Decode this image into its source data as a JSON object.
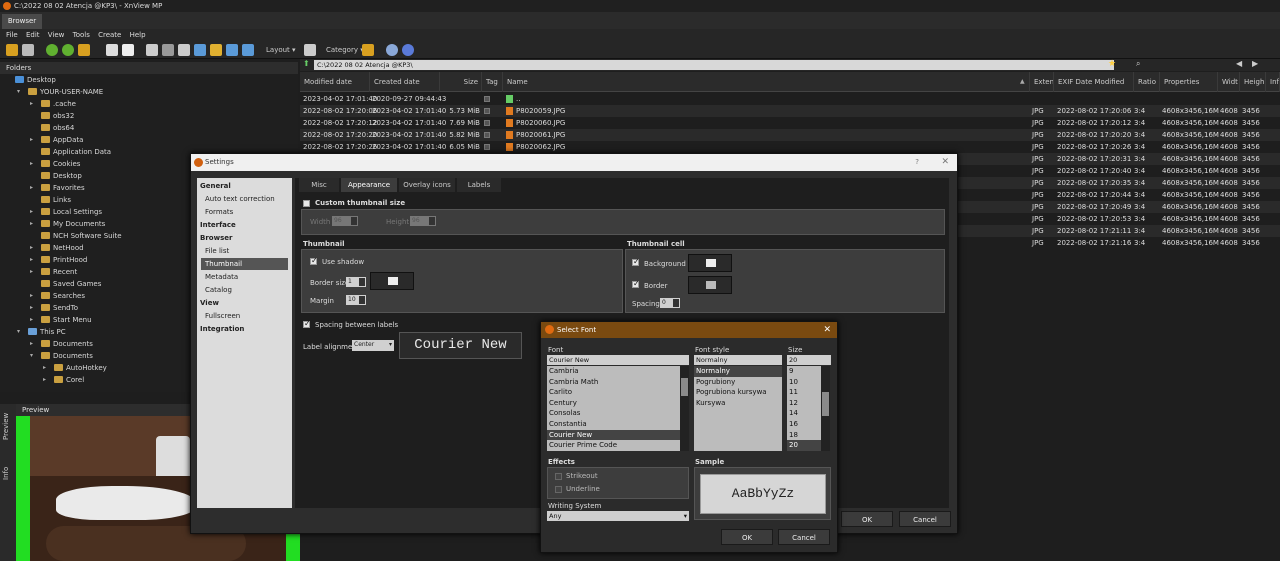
{
  "window": {
    "title": "C:\\2022 08 02 Atencja @KP3\\ - XnView MP"
  },
  "tabs": [
    {
      "label": "Browser"
    }
  ],
  "menu": [
    "File",
    "Edit",
    "View",
    "Tools",
    "Create",
    "Help"
  ],
  "toolbar": {
    "layout_label": "Layout",
    "category_label": "Category"
  },
  "path": {
    "value": "C:\\2022 08 02  Atencja @KP3\\"
  },
  "folders": {
    "header": "Folders",
    "items": [
      {
        "label": "Desktop",
        "indent": 0,
        "arrow": ""
      },
      {
        "label": "YOUR-USER-NAME",
        "indent": 1,
        "arrow": "▾"
      },
      {
        "label": ".cache",
        "indent": 2,
        "arrow": "▸"
      },
      {
        "label": "obs32",
        "indent": 2,
        "arrow": ""
      },
      {
        "label": "obs64",
        "indent": 2,
        "arrow": ""
      },
      {
        "label": "AppData",
        "indent": 2,
        "arrow": "▸"
      },
      {
        "label": "Application Data",
        "indent": 2,
        "arrow": ""
      },
      {
        "label": "Cookies",
        "indent": 2,
        "arrow": "▸"
      },
      {
        "label": "Desktop",
        "indent": 2,
        "arrow": ""
      },
      {
        "label": "Favorites",
        "indent": 2,
        "arrow": "▸"
      },
      {
        "label": "Links",
        "indent": 2,
        "arrow": ""
      },
      {
        "label": "Local Settings",
        "indent": 2,
        "arrow": "▸"
      },
      {
        "label": "My Documents",
        "indent": 2,
        "arrow": "▸"
      },
      {
        "label": "NCH Software Suite",
        "indent": 2,
        "arrow": ""
      },
      {
        "label": "NetHood",
        "indent": 2,
        "arrow": "▸"
      },
      {
        "label": "PrintHood",
        "indent": 2,
        "arrow": "▸"
      },
      {
        "label": "Recent",
        "indent": 2,
        "arrow": "▸"
      },
      {
        "label": "Saved Games",
        "indent": 2,
        "arrow": ""
      },
      {
        "label": "Searches",
        "indent": 2,
        "arrow": "▸"
      },
      {
        "label": "SendTo",
        "indent": 2,
        "arrow": "▸"
      },
      {
        "label": "Start Menu",
        "indent": 2,
        "arrow": "▸"
      },
      {
        "label": "This PC",
        "indent": 1,
        "arrow": "▾"
      },
      {
        "label": "Documents",
        "indent": 2,
        "arrow": "▸"
      },
      {
        "label": "Documents",
        "indent": 2,
        "arrow": "▾"
      },
      {
        "label": "AutoHotkey",
        "indent": 3,
        "arrow": "▸"
      },
      {
        "label": "Corel",
        "indent": 3,
        "arrow": "▸"
      }
    ]
  },
  "preview": {
    "header": "Preview",
    "side_tabs": [
      "Preview",
      "Info"
    ]
  },
  "grid": {
    "columns": [
      "Modified date",
      "Created date",
      "Size",
      "Tag",
      "Name",
      "Extens",
      "EXIF Date Modified",
      "Ratio",
      "Properties",
      "Widt",
      "Heigh",
      "Info"
    ],
    "rows": [
      {
        "modified": "2023-04-02 17:01:40",
        "created": "2020-09-27 09:44:43",
        "size": "",
        "name": "..",
        "ext": "",
        "exif": "",
        "ratio": "",
        "props": "",
        "w": "",
        "h": ""
      },
      {
        "modified": "2022-08-02 17:20:06",
        "created": "2023-04-02 17:01:40",
        "size": "5.73 MiB",
        "name": "P8020059.JPG",
        "ext": "JPG",
        "exif": "2022-08-02 17:20:06",
        "ratio": "3:4",
        "props": "4608x3456,16M",
        "w": "4608",
        "h": "3456"
      },
      {
        "modified": "2022-08-02 17:20:12",
        "created": "2023-04-02 17:01:40",
        "size": "7.69 MiB",
        "name": "P8020060.JPG",
        "ext": "JPG",
        "exif": "2022-08-02 17:20:12",
        "ratio": "3:4",
        "props": "4608x3456,16M",
        "w": "4608",
        "h": "3456"
      },
      {
        "modified": "2022-08-02 17:20:20",
        "created": "2023-04-02 17:01:40",
        "size": "5.82 MiB",
        "name": "P8020061.JPG",
        "ext": "JPG",
        "exif": "2022-08-02 17:20:20",
        "ratio": "3:4",
        "props": "4608x3456,16M",
        "w": "4608",
        "h": "3456"
      },
      {
        "modified": "2022-08-02 17:20:26",
        "created": "2023-04-02 17:01:40",
        "size": "6.05 MiB",
        "name": "P8020062.JPG",
        "ext": "JPG",
        "exif": "2022-08-02 17:20:26",
        "ratio": "3:4",
        "props": "4608x3456,16M",
        "w": "4608",
        "h": "3456"
      },
      {
        "ext": "JPG",
        "exif": "2022-08-02 17:20:31",
        "ratio": "3:4",
        "props": "4608x3456,16M",
        "w": "4608",
        "h": "3456"
      },
      {
        "ext": "JPG",
        "exif": "2022-08-02 17:20:40",
        "ratio": "3:4",
        "props": "4608x3456,16M",
        "w": "4608",
        "h": "3456"
      },
      {
        "ext": "JPG",
        "exif": "2022-08-02 17:20:35",
        "ratio": "3:4",
        "props": "4608x3456,16M",
        "w": "4608",
        "h": "3456"
      },
      {
        "ext": "JPG",
        "exif": "2022-08-02 17:20:44",
        "ratio": "3:4",
        "props": "4608x3456,16M",
        "w": "4608",
        "h": "3456"
      },
      {
        "ext": "JPG",
        "exif": "2022-08-02 17:20:49",
        "ratio": "3:4",
        "props": "4608x3456,16M",
        "w": "4608",
        "h": "3456"
      },
      {
        "ext": "JPG",
        "exif": "2022-08-02 17:20:53",
        "ratio": "3:4",
        "props": "4608x3456,16M",
        "w": "4608",
        "h": "3456"
      },
      {
        "ext": "JPG",
        "exif": "2022-08-02 17:21:11",
        "ratio": "3:4",
        "props": "4608x3456,16M",
        "w": "4608",
        "h": "3456"
      },
      {
        "ext": "JPG",
        "exif": "2022-08-02 17:21:16",
        "ratio": "3:4",
        "props": "4608x3456,16M",
        "w": "4608",
        "h": "3456"
      }
    ]
  },
  "settings": {
    "title": "Settings",
    "help": "?",
    "close": "✕",
    "nav": [
      {
        "label": "General",
        "type": "h"
      },
      {
        "label": "Auto text correction",
        "type": "sub"
      },
      {
        "label": "Formats",
        "type": "sub"
      },
      {
        "label": "Interface",
        "type": "h"
      },
      {
        "label": "Browser",
        "type": "h"
      },
      {
        "label": "File list",
        "type": "sub"
      },
      {
        "label": "Thumbnail",
        "type": "sel"
      },
      {
        "label": "Metadata",
        "type": "sub"
      },
      {
        "label": "Catalog",
        "type": "sub"
      },
      {
        "label": "View",
        "type": "h"
      },
      {
        "label": "Fullscreen",
        "type": "sub"
      },
      {
        "label": "Integration",
        "type": "h"
      }
    ],
    "tabs": [
      "Misc",
      "Appearance",
      "Overlay icons",
      "Labels"
    ],
    "custom_size": "Custom thumbnail size",
    "width_label": "Width",
    "width_value": "96",
    "height_label": "Height",
    "height_value": "96",
    "thumbnail_title": "Thumbnail",
    "use_shadow": "Use shadow",
    "border_size_label": "Border size",
    "border_size_value": "1",
    "margin_label": "Margin",
    "margin_value": "10",
    "cell_title": "Thumbnail cell",
    "background_label": "Background",
    "border_label": "Border",
    "spacing_label": "Spacing",
    "spacing_value": "0",
    "spacing_between": "Spacing between labels",
    "label_alignment": "Label alignment",
    "alignment_value": "Center",
    "font_preview": "Courier New",
    "ok": "OK",
    "cancel": "Cancel"
  },
  "select_font": {
    "title": "Select Font",
    "font_label": "Font",
    "font_value": "Courier New",
    "fonts": [
      "Cambria",
      "Cambria Math",
      "Carlito",
      "Century",
      "Consolas",
      "Constantia",
      "Courier New",
      "Courier Prime Code"
    ],
    "selected_font": "Courier New",
    "style_label": "Font style",
    "style_value": "Normalny",
    "styles": [
      "Normalny",
      "Pogrubiony",
      "Pogrubiona kursywa",
      "Kursywa"
    ],
    "selected_style": "Normalny",
    "size_label": "Size",
    "size_value": "20",
    "sizes": [
      "9",
      "10",
      "11",
      "12",
      "14",
      "16",
      "18",
      "20",
      "22"
    ],
    "selected_size": "20",
    "effects_label": "Effects",
    "strikeout": "Strikeout",
    "underline": "Underline",
    "sample_label": "Sample",
    "sample_text": "AaBbYyZz",
    "writing_system_label": "Writing System",
    "writing_system_value": "Any",
    "ok": "OK",
    "cancel": "Cancel"
  }
}
